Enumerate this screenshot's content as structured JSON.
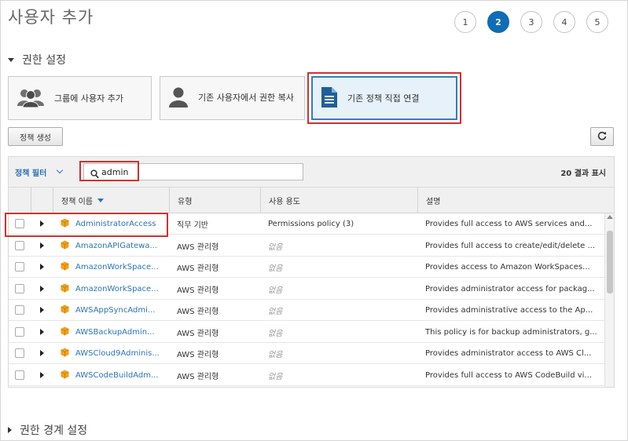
{
  "page": {
    "title": "사용자 추가"
  },
  "steps": [
    "1",
    "2",
    "3",
    "4",
    "5"
  ],
  "active_step": "2",
  "permissions": {
    "section_title": "권한 설정",
    "options": [
      {
        "label": "그룹에 사용자 추가",
        "icon": "group-icon"
      },
      {
        "label": "기존 사용자에서 권한 복사",
        "icon": "user-icon"
      },
      {
        "label": "기존 정책 직접 연결",
        "icon": "document-icon"
      }
    ],
    "selected_option": "기존 정책 직접 연결"
  },
  "toolbar": {
    "create_policy_label": "정책 생성",
    "refresh_icon": "refresh-icon"
  },
  "filter": {
    "label": "정책 필터",
    "search_value": "admin",
    "result_count": "20 결과 표시"
  },
  "table": {
    "headers": {
      "name": "정책 이름",
      "type": "유형",
      "usage": "사용 용도",
      "description": "설명"
    },
    "rows": [
      {
        "name": "AdministratorAccess",
        "type": "직무 기반",
        "usage": "Permissions policy (3)",
        "usage_muted": false,
        "description": "Provides full access to AWS services and..."
      },
      {
        "name": "AmazonAPIGatewa...",
        "type": "AWS 관리형",
        "usage": "없음",
        "usage_muted": true,
        "description": "Provides full access to create/edit/delete ..."
      },
      {
        "name": "AmazonWorkSpace...",
        "type": "AWS 관리형",
        "usage": "없음",
        "usage_muted": true,
        "description": "Provides access to Amazon WorkSpaces..."
      },
      {
        "name": "AmazonWorkSpace...",
        "type": "AWS 관리형",
        "usage": "없음",
        "usage_muted": true,
        "description": "Provides administrator access for packag..."
      },
      {
        "name": "AWSAppSyncAdmi...",
        "type": "AWS 관리형",
        "usage": "없음",
        "usage_muted": true,
        "description": "Provides administrative access to the Ap..."
      },
      {
        "name": "AWSBackupAdmin...",
        "type": "AWS 관리형",
        "usage": "없음",
        "usage_muted": true,
        "description": "This policy is for backup administrators, g..."
      },
      {
        "name": "AWSCloud9Adminis...",
        "type": "AWS 관리형",
        "usage": "없음",
        "usage_muted": true,
        "description": "Provides administrator access to AWS Cl..."
      },
      {
        "name": "AWSCodeBuildAdm...",
        "type": "AWS 관리형",
        "usage": "없음",
        "usage_muted": true,
        "description": "Provides full access to AWS CodeBuild vi..."
      }
    ]
  },
  "boundary": {
    "section_title": "권한 경계 설정"
  },
  "colors": {
    "accent": "#0f6cb6",
    "link": "#2b73b7",
    "highlight": "#d0312d",
    "policy_icon": "#f0a21a"
  }
}
